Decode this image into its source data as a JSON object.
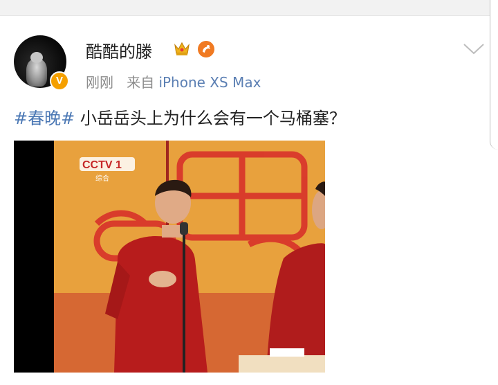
{
  "post": {
    "username": "酷酷的滕",
    "meta": {
      "time": "刚刚",
      "from_label": "来自",
      "source": "iPhone XS Max"
    },
    "hashtag": "#春晚#",
    "text": " 小岳岳头上为什么会有一个马桶塞？",
    "avatar_badge": "V",
    "icons": [
      "crown-icon",
      "medal-icon",
      "chevron-down-icon"
    ]
  },
  "video_frame": {
    "channel_logo": "CCTV 1",
    "channel_sub": "综合"
  },
  "colors": {
    "hashtag": "#4a77b4",
    "source": "#5b7fb3",
    "badge": "#f5a000",
    "stage_red": "#b71c1c",
    "stage_gold": "#e9a23b"
  }
}
